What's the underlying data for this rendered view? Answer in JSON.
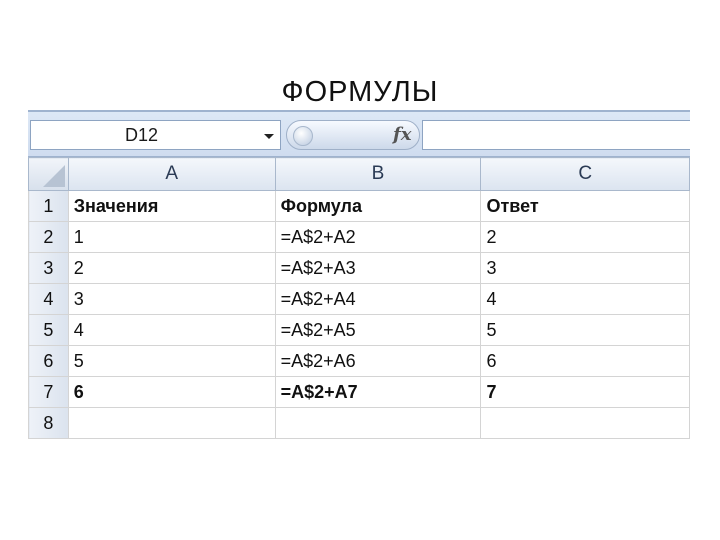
{
  "slide": {
    "title": "ФОРМУЛЫ"
  },
  "namebox": {
    "value": "D12"
  },
  "formula_bar": {
    "fx_label": "fx",
    "content": ""
  },
  "columns": [
    "A",
    "B",
    "C"
  ],
  "rows": [
    {
      "num": "1",
      "a": "Значения",
      "b": "Формула",
      "c": "Ответ"
    },
    {
      "num": "2",
      "a": "1",
      "b": "=A$2+A2",
      "c": "2"
    },
    {
      "num": "3",
      "a": "2",
      "b": "=A$2+A3",
      "c": "3"
    },
    {
      "num": "4",
      "a": "3",
      "b": "=A$2+A4",
      "c": "4"
    },
    {
      "num": "5",
      "a": "4",
      "b": "=A$2+A5",
      "c": "5"
    },
    {
      "num": "6",
      "a": "5",
      "b": "=A$2+A6",
      "c": "6"
    },
    {
      "num": "7",
      "a": "6",
      "b": "=A$2+A7",
      "c": "7"
    },
    {
      "num": "8",
      "a": "",
      "b": "",
      "c": ""
    }
  ]
}
